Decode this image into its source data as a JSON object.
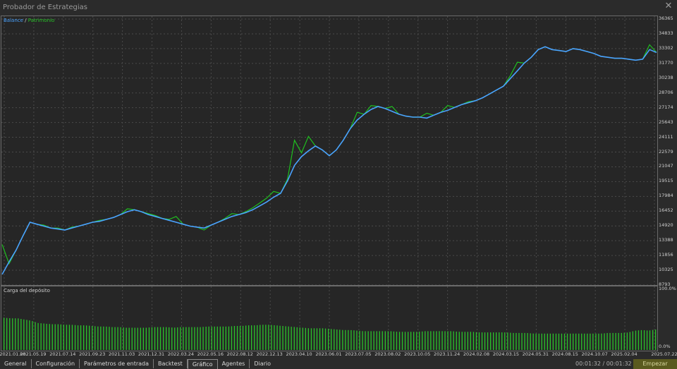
{
  "window": {
    "title": "Probador de Estrategias",
    "close_icon": "close-icon"
  },
  "legend": {
    "balance": "Balance",
    "separator": "/",
    "equity": "Patrimonio"
  },
  "load_panel": {
    "title": "Carga del depósito",
    "top_label": "100.0%",
    "bottom_label": "0.0%"
  },
  "colors": {
    "balance": "#4aa3ff",
    "equity": "#1fbf1f",
    "bars": "#2bc42b",
    "grid": "#4a4a4a"
  },
  "chart_data": {
    "type": "line",
    "y_ticks": [
      "36365",
      "34833",
      "33302",
      "31770",
      "30238",
      "28706",
      "27174",
      "25643",
      "24111",
      "22579",
      "21047",
      "19515",
      "17984",
      "16452",
      "14920",
      "13388",
      "11856",
      "10325",
      "8793"
    ],
    "ylim": [
      8793,
      36365
    ],
    "x_ticks": [
      "2021.01.08",
      "2021.05.19",
      "2021.07.14",
      "2021.09.23",
      "2021.11.03",
      "2021.12.31",
      "2022.03.24",
      "2022.05.16",
      "2022.08.12",
      "2022.12.13",
      "2023.04.10",
      "2023.06.01",
      "2023.07.05",
      "2023.08.02",
      "2023.10.05",
      "2023.11.24",
      "2024.02.08",
      "2024.03.15",
      "2024.05.31",
      "2024.08.15",
      "2024.10.07",
      "2025.02.04",
      "2025.07.22"
    ],
    "series": [
      {
        "name": "Balance",
        "values": [
          9900,
          11200,
          12400,
          13900,
          15300,
          15100,
          14900,
          14700,
          14600,
          14500,
          14700,
          14900,
          15100,
          15300,
          15400,
          15600,
          15800,
          16100,
          16400,
          16600,
          16400,
          16100,
          15900,
          15700,
          15500,
          15300,
          15100,
          14900,
          14800,
          14700,
          15000,
          15300,
          15600,
          15900,
          16100,
          16300,
          16600,
          17000,
          17400,
          17900,
          18300,
          19600,
          21200,
          22100,
          22700,
          23200,
          22800,
          22200,
          22800,
          23800,
          25000,
          25900,
          26500,
          27000,
          27300,
          27100,
          26800,
          26500,
          26300,
          26200,
          26200,
          26100,
          26400,
          26700,
          26900,
          27200,
          27500,
          27700,
          27900,
          28200,
          28600,
          29000,
          29400,
          30200,
          31000,
          31800,
          32400,
          33200,
          33500,
          33200,
          33100,
          33000,
          33300,
          33200,
          33000,
          32800,
          32500,
          32400,
          32300,
          32300,
          32200,
          32100,
          32200,
          33200,
          32900
        ]
      },
      {
        "name": "Patrimonio",
        "values": [
          13000,
          11000,
          12400,
          13900,
          15300,
          15100,
          15000,
          14700,
          14700,
          14500,
          14800,
          14900,
          15100,
          15300,
          15500,
          15600,
          15800,
          16100,
          16700,
          16600,
          16400,
          16200,
          16000,
          15700,
          15600,
          15900,
          15100,
          14900,
          14800,
          14500,
          15000,
          15300,
          15700,
          16200,
          16100,
          16400,
          16800,
          17300,
          17800,
          18500,
          18300,
          19800,
          23800,
          22500,
          24200,
          23200,
          22800,
          22200,
          22800,
          23800,
          25000,
          26700,
          26500,
          27400,
          27300,
          27100,
          27300,
          26500,
          26300,
          26200,
          26200,
          26600,
          26400,
          26700,
          27400,
          27200,
          27500,
          27800,
          27900,
          28200,
          28600,
          29000,
          29400,
          30500,
          31900,
          31800,
          32400,
          33200,
          33500,
          33200,
          33100,
          33000,
          33300,
          33200,
          33000,
          32800,
          32500,
          32400,
          32300,
          32300,
          32200,
          32100,
          32200,
          33700,
          32900
        ]
      }
    ],
    "load_values": [
      0.55,
      0.54,
      0.54,
      0.52,
      0.5,
      0.46,
      0.45,
      0.44,
      0.44,
      0.43,
      0.43,
      0.42,
      0.42,
      0.41,
      0.4,
      0.4,
      0.39,
      0.39,
      0.38,
      0.38,
      0.38,
      0.38,
      0.39,
      0.39,
      0.39,
      0.38,
      0.39,
      0.39,
      0.39,
      0.39,
      0.4,
      0.4,
      0.4,
      0.4,
      0.41,
      0.41,
      0.42,
      0.42,
      0.43,
      0.43,
      0.42,
      0.41,
      0.4,
      0.39,
      0.38,
      0.37,
      0.37,
      0.37,
      0.36,
      0.35,
      0.34,
      0.34,
      0.33,
      0.32,
      0.32,
      0.32,
      0.32,
      0.32,
      0.31,
      0.31,
      0.31,
      0.31,
      0.32,
      0.32,
      0.32,
      0.32,
      0.32,
      0.31,
      0.31,
      0.31,
      0.3,
      0.3,
      0.3,
      0.3,
      0.3,
      0.29,
      0.29,
      0.29,
      0.28,
      0.28,
      0.28,
      0.28,
      0.28,
      0.28,
      0.28,
      0.28,
      0.28,
      0.28,
      0.28,
      0.29,
      0.29,
      0.29,
      0.3,
      0.33,
      0.34,
      0.33,
      0.35
    ]
  },
  "tabs": [
    "General",
    "Configuración",
    "Parámetros de entrada",
    "Backtest",
    "Gráfico",
    "Agentes",
    "Diario"
  ],
  "active_tab": "Gráfico",
  "timer": "00:01:32 / 00:01:32",
  "start_button": "Empezar"
}
